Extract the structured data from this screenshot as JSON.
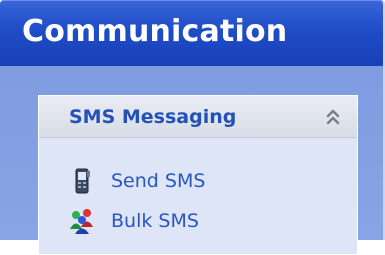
{
  "header": {
    "title": "Communication"
  },
  "panel": {
    "title": "SMS Messaging",
    "collapse_icon": "double-chevron-up-icon",
    "items": [
      {
        "label": "Send SMS",
        "icon": "mobile-phone-icon"
      },
      {
        "label": "Bulk SMS",
        "icon": "multiple-people-icon"
      }
    ]
  },
  "colors": {
    "header_bg": "#1f4cc8",
    "frame_bg": "#7e9ce0",
    "panel_bg": "#dde5f6",
    "panel_title": "#2451b8",
    "link": "#2a56c2"
  }
}
